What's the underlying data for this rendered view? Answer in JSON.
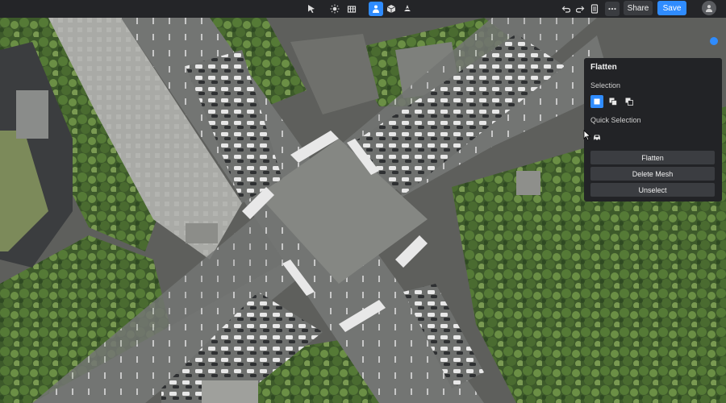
{
  "toolbar": {
    "tools": [
      {
        "icon": "pointer-icon",
        "active": false
      },
      {
        "icon": "sun-icon",
        "active": false
      },
      {
        "icon": "scene-icon",
        "active": false
      },
      {
        "icon": "person-icon",
        "active": true
      },
      {
        "icon": "cube-icon",
        "active": false
      },
      {
        "icon": "compass-icon",
        "active": false
      }
    ],
    "share_label": "Share",
    "save_label": "Save"
  },
  "panel": {
    "title": "Flatten",
    "selection_label": "Selection",
    "quick_selection_label": "Quick Selection",
    "buttons": [
      "Flatten",
      "Delete Mesh",
      "Unselect"
    ]
  },
  "colors": {
    "accent": "#2f8cff",
    "toolbar_bg": "#242528",
    "panel_bg": "#222326"
  }
}
